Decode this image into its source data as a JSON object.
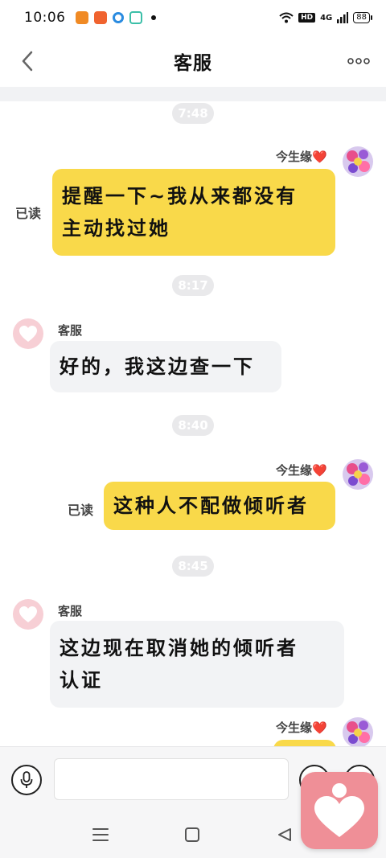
{
  "status_bar": {
    "time": "10:06",
    "hd": "HD",
    "network": "4G",
    "battery": "88"
  },
  "header": {
    "title": "客服"
  },
  "messages": [
    {
      "time": "7:48"
    },
    {
      "sender": "今生缘❤️",
      "text_lines": [
        "提醒一下~我从来都没有",
        "主动找过她"
      ],
      "read": "已读"
    },
    {
      "time": "8:17"
    },
    {
      "sender": "客服",
      "text": "好的，我这边查一下"
    },
    {
      "time": "8:40"
    },
    {
      "sender": "今生缘❤️",
      "text": "这种人不配做倾听者",
      "read": "已读"
    },
    {
      "time": "8:45"
    },
    {
      "sender": "客服",
      "text_lines": [
        "这边现在取消她的倾听者",
        "认证"
      ]
    },
    {
      "sender": "今生缘❤️"
    }
  ],
  "input": {
    "placeholder": ""
  },
  "colors": {
    "outgoing_bubble": "#f9d94a",
    "incoming_bubble": "#f2f3f5",
    "float_app": "#ef8f97"
  },
  "icons": {
    "back": "chevron-left-icon",
    "more": "more-dots-icon",
    "mic": "microphone-icon",
    "emoji": "emoji-icon",
    "plus": "plus-icon",
    "nav_menu": "menu-icon",
    "nav_home": "home-square-icon",
    "nav_back": "triangle-back-icon",
    "float_app": "heart-app-icon"
  }
}
